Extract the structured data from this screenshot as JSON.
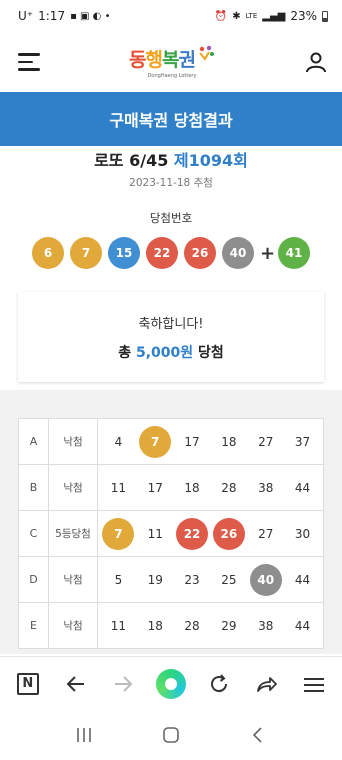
{
  "status_bar": {
    "carrier": "U⁺",
    "time": "1:17",
    "network": "LTE",
    "battery": "23%"
  },
  "header": {
    "logo_text": [
      "동",
      "행",
      "복",
      "권"
    ],
    "logo_sub": "DongHaeng Lottery"
  },
  "banner": {
    "title": "구매복권 당첨결과"
  },
  "draw": {
    "game": "로또 6/45",
    "number": "제1094회",
    "date": "2023-11-18 추첨",
    "numbers_label": "당첨번호",
    "balls": [
      {
        "n": "6",
        "color": "#e0a93a"
      },
      {
        "n": "7",
        "color": "#e0a93a"
      },
      {
        "n": "15",
        "color": "#3f8fd2"
      },
      {
        "n": "22",
        "color": "#de5b4a"
      },
      {
        "n": "26",
        "color": "#de5b4a"
      },
      {
        "n": "40",
        "color": "#8e8e8e"
      }
    ],
    "plus": "+",
    "bonus": {
      "n": "41",
      "color": "#5fb346"
    }
  },
  "result": {
    "message": "축하합니다!",
    "prize_prefix": "총",
    "prize_amount": "5,000원",
    "prize_suffix": "당첨"
  },
  "rows": [
    {
      "letter": "A",
      "result": "낙첨",
      "nums": [
        {
          "n": "4"
        },
        {
          "n": "7",
          "color": "#e0a93a"
        },
        {
          "n": "17"
        },
        {
          "n": "18"
        },
        {
          "n": "27"
        },
        {
          "n": "37"
        }
      ]
    },
    {
      "letter": "B",
      "result": "낙첨",
      "nums": [
        {
          "n": "11"
        },
        {
          "n": "17"
        },
        {
          "n": "18"
        },
        {
          "n": "28"
        },
        {
          "n": "38"
        },
        {
          "n": "44"
        }
      ]
    },
    {
      "letter": "C",
      "result": "5등당첨",
      "nums": [
        {
          "n": "7",
          "color": "#e0a93a"
        },
        {
          "n": "11"
        },
        {
          "n": "22",
          "color": "#de5b4a"
        },
        {
          "n": "26",
          "color": "#de5b4a"
        },
        {
          "n": "27"
        },
        {
          "n": "30"
        }
      ]
    },
    {
      "letter": "D",
      "result": "낙첨",
      "nums": [
        {
          "n": "5"
        },
        {
          "n": "19"
        },
        {
          "n": "23"
        },
        {
          "n": "25"
        },
        {
          "n": "40",
          "color": "#8e8e8e"
        },
        {
          "n": "44"
        }
      ]
    },
    {
      "letter": "E",
      "result": "낙첨",
      "nums": [
        {
          "n": "11"
        },
        {
          "n": "18"
        },
        {
          "n": "28"
        },
        {
          "n": "29"
        },
        {
          "n": "38"
        },
        {
          "n": "44"
        }
      ]
    }
  ],
  "toolbar": {
    "n_label": "N",
    "icons": [
      "n-home-icon",
      "back-arrow-icon",
      "forward-arrow-icon",
      "green-orb-icon",
      "refresh-icon",
      "share-icon",
      "menu-icon"
    ]
  },
  "navbar": {
    "icons": [
      "recent-apps-icon",
      "home-icon",
      "back-icon"
    ]
  }
}
